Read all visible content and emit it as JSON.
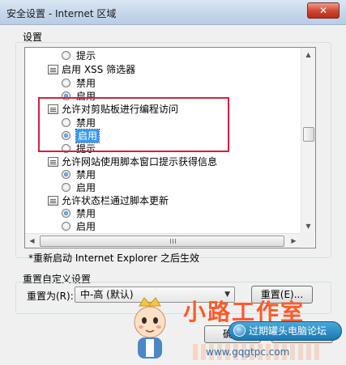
{
  "window": {
    "title": "安全设置 - Internet 区域",
    "close_label": "✕"
  },
  "settings": {
    "label": "设置",
    "rows": [
      {
        "kind": "radio",
        "label": "提示",
        "checked": false
      },
      {
        "kind": "group",
        "label": "启用 XSS 筛选器"
      },
      {
        "kind": "radio",
        "label": "禁用",
        "checked": false
      },
      {
        "kind": "radio",
        "label": "启用",
        "checked": true
      },
      {
        "kind": "group",
        "label": "允许对剪贴板进行编程访问"
      },
      {
        "kind": "radio",
        "label": "禁用",
        "checked": false
      },
      {
        "kind": "radio",
        "label": "启用",
        "checked": true
      },
      {
        "kind": "radio",
        "label": "提示",
        "checked": false
      },
      {
        "kind": "group",
        "label": "允许网站使用脚本窗口提示获得信息"
      },
      {
        "kind": "radio",
        "label": "禁用",
        "checked": true
      },
      {
        "kind": "radio",
        "label": "启用",
        "checked": false
      },
      {
        "kind": "group",
        "label": "允许状态栏通过脚本更新"
      },
      {
        "kind": "radio",
        "label": "禁用",
        "checked": true
      },
      {
        "kind": "radio",
        "label": "启用",
        "checked": false
      }
    ]
  },
  "note": "*重新启动 Internet Explorer 之后生效",
  "reset": {
    "section_label": "重置自定义设置",
    "reset_to_label": "重置为(R):",
    "level_value": "中-高 (默认)",
    "reset_button": "重置(E)..."
  },
  "footer": {
    "ok_button": "确定",
    "cancel_button": "取消"
  },
  "watermark": {
    "brand": "小路工作室",
    "badge": "过期罐头电脑论坛",
    "url": "www.gqgtpc.com"
  }
}
